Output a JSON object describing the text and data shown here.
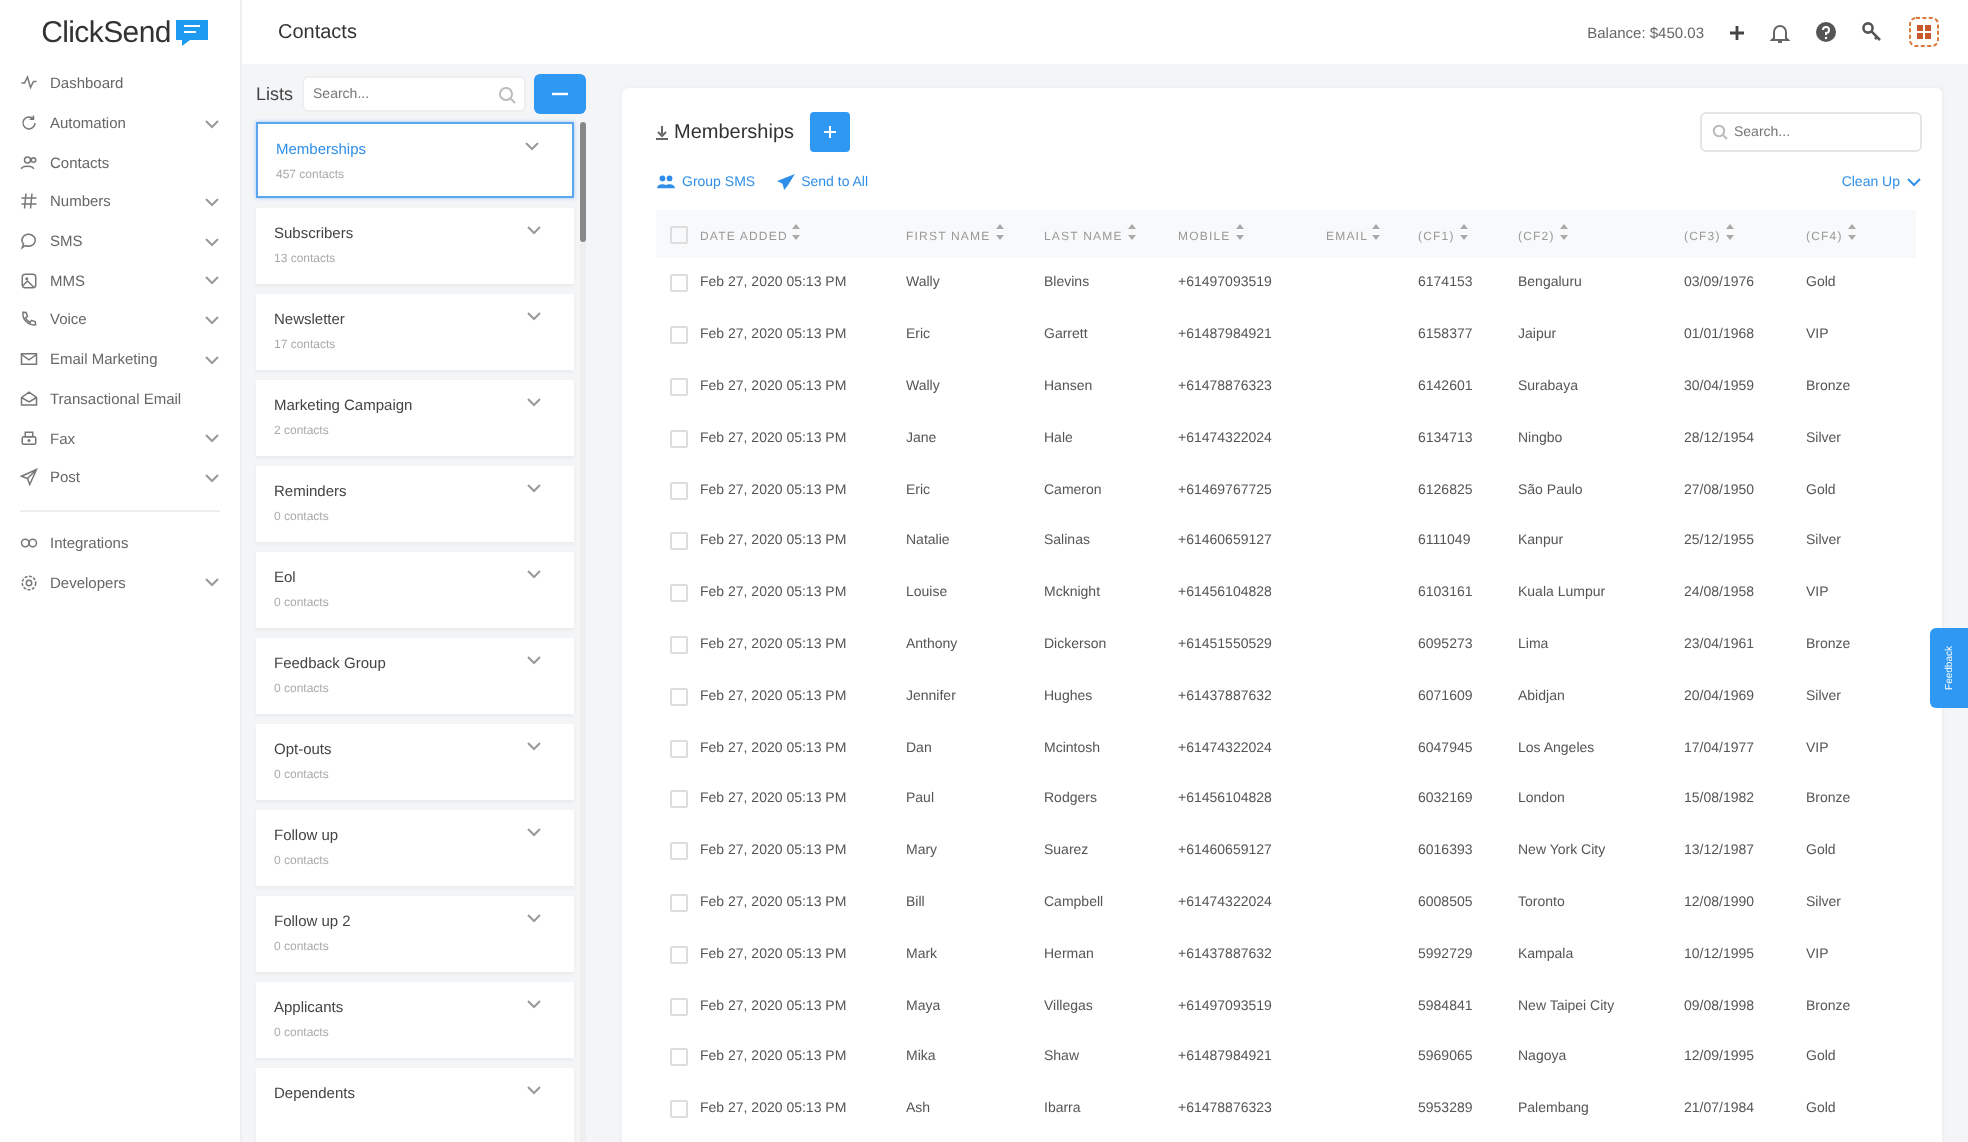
{
  "logo": {
    "text": "ClickSend"
  },
  "sidebar": {
    "items": [
      {
        "label": "Dashboard",
        "submenu": false
      },
      {
        "label": "Automation",
        "submenu": true
      },
      {
        "label": "Contacts",
        "submenu": false
      },
      {
        "label": "Numbers",
        "submenu": true
      },
      {
        "label": "SMS",
        "submenu": true
      },
      {
        "label": "MMS",
        "submenu": true
      },
      {
        "label": "Voice",
        "submenu": true
      },
      {
        "label": "Email Marketing",
        "submenu": true
      },
      {
        "label": "Transactional Email",
        "submenu": false
      },
      {
        "label": "Fax",
        "submenu": true
      },
      {
        "label": "Post",
        "submenu": true
      }
    ],
    "footer_items": [
      {
        "label": "Integrations",
        "submenu": false
      },
      {
        "label": "Developers",
        "submenu": true
      }
    ]
  },
  "header": {
    "title": "Contacts",
    "balance": "Balance: $450.03"
  },
  "lists": {
    "label": "Lists",
    "search": {
      "placeholder": "Search..."
    },
    "items": [
      {
        "name": "Memberships",
        "count": "457 contacts",
        "selected": true
      },
      {
        "name": "Subscribers",
        "count": "13 contacts",
        "selected": false
      },
      {
        "name": "Newsletter",
        "count": "17 contacts",
        "selected": false
      },
      {
        "name": "Marketing Campaign",
        "count": "2 contacts",
        "selected": false
      },
      {
        "name": "Reminders",
        "count": "0 contacts",
        "selected": false
      },
      {
        "name": "Eol",
        "count": "0 contacts",
        "selected": false
      },
      {
        "name": "Feedback Group",
        "count": "0 contacts",
        "selected": false
      },
      {
        "name": "Opt-outs",
        "count": "0 contacts",
        "selected": false
      },
      {
        "name": "Follow up",
        "count": "0 contacts",
        "selected": false
      },
      {
        "name": "Follow up 2",
        "count": "0 contacts",
        "selected": false
      },
      {
        "name": "Applicants",
        "count": "0 contacts",
        "selected": false
      },
      {
        "name": "Dependents",
        "selected": false
      }
    ]
  },
  "main": {
    "title": "Memberships",
    "search": {
      "placeholder": "Search..."
    },
    "actions": [
      "Group SMS",
      "Send to All"
    ],
    "clean_up": "Clean Up",
    "table": {
      "all_checked": false,
      "columns": [
        "DATE ADDED",
        "FIRST NAME",
        "LAST NAME",
        "MOBILE",
        "EMAIL",
        "(CF1)",
        "(CF2)",
        "(CF3)",
        "(CF4)"
      ],
      "rows": [
        {
          "checked": false,
          "cells": [
            "Feb 27, 2020 05:13 PM",
            "Wally",
            "Blevins",
            "+61497093519",
            "",
            "6174153",
            "Bengaluru",
            "03/09/1976",
            "Gold"
          ]
        },
        {
          "checked": false,
          "cells": [
            "Feb 27, 2020 05:13 PM",
            "Eric",
            "Garrett",
            "+61487984921",
            "",
            "6158377",
            "Jaipur",
            "01/01/1968",
            "VIP"
          ]
        },
        {
          "checked": false,
          "cells": [
            "Feb 27, 2020 05:13 PM",
            "Wally",
            "Hansen",
            "+61478876323",
            "",
            "6142601",
            "Surabaya",
            "30/04/1959",
            "Bronze"
          ]
        },
        {
          "checked": false,
          "cells": [
            "Feb 27, 2020 05:13 PM",
            "Jane",
            "Hale",
            "+61474322024",
            "",
            "6134713",
            "Ningbo",
            "28/12/1954",
            "Silver"
          ]
        },
        {
          "checked": false,
          "cells": [
            "Feb 27, 2020 05:13 PM",
            "Eric",
            "Cameron",
            "+61469767725",
            "",
            "6126825",
            "São Paulo",
            "27/08/1950",
            "Gold"
          ]
        },
        {
          "checked": false,
          "cells": [
            "Feb 27, 2020 05:13 PM",
            "Natalie",
            "Salinas",
            "+61460659127",
            "",
            "6111049",
            "Kanpur",
            "25/12/1955",
            "Silver"
          ]
        },
        {
          "checked": false,
          "cells": [
            "Feb 27, 2020 05:13 PM",
            "Louise",
            "Mcknight",
            "+61456104828",
            "",
            "6103161",
            "Kuala Lumpur",
            "24/08/1958",
            "VIP"
          ]
        },
        {
          "checked": false,
          "cells": [
            "Feb 27, 2020 05:13 PM",
            "Anthony",
            "Dickerson",
            "+61451550529",
            "",
            "6095273",
            "Lima",
            "23/04/1961",
            "Bronze"
          ]
        },
        {
          "checked": false,
          "cells": [
            "Feb 27, 2020 05:13 PM",
            "Jennifer",
            "Hughes",
            "+61437887632",
            "",
            "6071609",
            "Abidjan",
            "20/04/1969",
            "Silver"
          ]
        },
        {
          "checked": false,
          "cells": [
            "Feb 27, 2020 05:13 PM",
            "Dan",
            "Mcintosh",
            "+61474322024",
            "",
            "6047945",
            "Los Angeles",
            "17/04/1977",
            "VIP"
          ]
        },
        {
          "checked": false,
          "cells": [
            "Feb 27, 2020 05:13 PM",
            "Paul",
            "Rodgers",
            "+61456104828",
            "",
            "6032169",
            "London",
            "15/08/1982",
            "Bronze"
          ]
        },
        {
          "checked": false,
          "cells": [
            "Feb 27, 2020 05:13 PM",
            "Mary",
            "Suarez",
            "+61460659127",
            "",
            "6016393",
            "New York City",
            "13/12/1987",
            "Gold"
          ]
        },
        {
          "checked": false,
          "cells": [
            "Feb 27, 2020 05:13 PM",
            "Bill",
            "Campbell",
            "+61474322024",
            "",
            "6008505",
            "Toronto",
            "12/08/1990",
            "Silver"
          ]
        },
        {
          "checked": false,
          "cells": [
            "Feb 27, 2020 05:13 PM",
            "Mark",
            "Herman",
            "+61437887632",
            "",
            "5992729",
            "Kampala",
            "10/12/1995",
            "VIP"
          ]
        },
        {
          "checked": false,
          "cells": [
            "Feb 27, 2020 05:13 PM",
            "Maya",
            "Villegas",
            "+61497093519",
            "",
            "5984841",
            "New Taipei City",
            "09/08/1998",
            "Bronze"
          ]
        },
        {
          "checked": false,
          "cells": [
            "Feb 27, 2020 05:13 PM",
            "Mika",
            "Shaw",
            "+61487984921",
            "",
            "5969065",
            "Nagoya",
            "12/09/1995",
            "Gold"
          ]
        },
        {
          "checked": false,
          "cells": [
            "Feb 27, 2020 05:13 PM",
            "Ash",
            "Ibarra",
            "+61478876323",
            "",
            "5953289",
            "Palembang",
            "21/07/1984",
            "Gold"
          ]
        }
      ]
    }
  },
  "feedback": {
    "label": "Feedback"
  }
}
